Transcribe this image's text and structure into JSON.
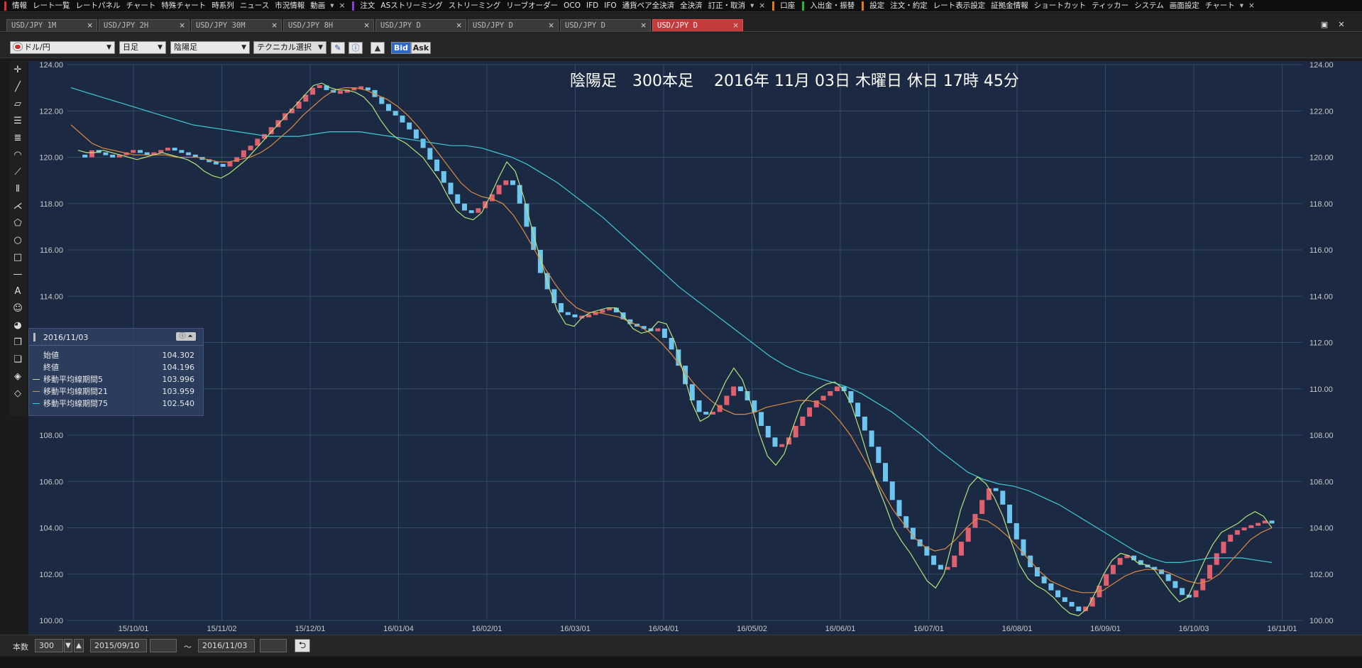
{
  "menu": {
    "groups": [
      {
        "color": "#e03030",
        "items": [
          "情報",
          "レート一覧",
          "レートパネル",
          "チャート",
          "特殊チャート",
          "時系列",
          "ニュース",
          "市況情報",
          "動画"
        ]
      },
      {
        "color": "#8a3fd0",
        "items": [
          "注文",
          "ASストリーミング",
          "ストリーミング",
          "リーブオーダー",
          "OCO",
          "IFD",
          "IFO",
          "通貨ペア全決済",
          "全決済",
          "訂正・取消"
        ]
      },
      {
        "color": "#e07a20",
        "items": [
          "口座"
        ]
      },
      {
        "color": "#30b030",
        "items": [
          "入出金・振替"
        ]
      },
      {
        "color": "#e07a20",
        "items": [
          "設定",
          "注文・約定",
          "レート表示設定",
          "証拠金情報",
          "ショートカット",
          "ティッカー",
          "システム",
          "画面設定",
          "チャート"
        ]
      }
    ]
  },
  "tabs": [
    {
      "label": "USD/JPY 1M",
      "active": false
    },
    {
      "label": "USD/JPY 2H",
      "active": false
    },
    {
      "label": "USD/JPY 30M",
      "active": false
    },
    {
      "label": "USD/JPY 8H",
      "active": false
    },
    {
      "label": "USD/JPY D",
      "active": false
    },
    {
      "label": "USD/JPY D",
      "active": false
    },
    {
      "label": "USD/JPY D",
      "active": false
    },
    {
      "label": "USD/JPY D",
      "active": true
    }
  ],
  "toolbar": {
    "pair": "ドル/円",
    "period": "日足",
    "chart_type": "陰陽足",
    "technical": "テクニカル選択",
    "bid": "Bid",
    "ask": "Ask"
  },
  "chart_header": "陰陽足　300本足　 2016年 11月 03日 木曜日 休日 17時 45分",
  "info": {
    "date": "2016/11/03",
    "rows": [
      {
        "label": "始値",
        "value": "104.302",
        "color": ""
      },
      {
        "label": "終値",
        "value": "104.196",
        "color": ""
      },
      {
        "label": "移動平均線期間5",
        "value": "103.996",
        "color": "#b8e07a"
      },
      {
        "label": "移動平均線期間21",
        "value": "103.959",
        "color": "#e08a40"
      },
      {
        "label": "移動平均線期間75",
        "value": "102.540",
        "color": "#40c8d8"
      }
    ]
  },
  "status": {
    "bars_label": "本数",
    "bars_value": "300",
    "from_date": "2015/09/10",
    "tilde": "～",
    "to_date": "2016/11/03"
  },
  "chart_data": {
    "type": "line",
    "ylim": [
      100.0,
      124.0
    ],
    "yticks": [
      "124.00",
      "122.00",
      "120.00",
      "118.00",
      "116.00",
      "114.00",
      "112.00",
      "110.00",
      "108.00",
      "106.00",
      "104.00",
      "102.00",
      "100.00"
    ],
    "xticks": [
      "15/10/01",
      "15/11/02",
      "15/12/01",
      "16/01/04",
      "16/02/01",
      "16/03/01",
      "16/04/01",
      "16/05/02",
      "16/06/01",
      "16/07/01",
      "16/08/01",
      "16/09/01",
      "16/10/03",
      "16/11/01"
    ],
    "colors": {
      "up": "#e06070",
      "down": "#6cc6f0",
      "ma5": "#b8e07a",
      "ma21": "#e08a40",
      "ma75": "#40c8d8",
      "bg": "#1b2a42",
      "grid": "#34476a",
      "text": "#c8c8c8"
    },
    "price": [
      120.1,
      120.0,
      120.3,
      120.2,
      120.1,
      120.0,
      120.1,
      120.2,
      120.3,
      120.2,
      120.1,
      120.2,
      120.3,
      120.4,
      120.3,
      120.2,
      120.1,
      120.0,
      119.9,
      119.8,
      119.7,
      119.6,
      119.8,
      120.0,
      120.3,
      120.5,
      120.8,
      121.0,
      121.3,
      121.6,
      121.9,
      122.1,
      122.4,
      122.7,
      123.0,
      123.1,
      122.9,
      122.8,
      122.8,
      122.9,
      123.0,
      123.0,
      122.9,
      122.6,
      122.3,
      122.0,
      121.8,
      121.5,
      121.2,
      120.8,
      120.4,
      119.9,
      119.4,
      118.9,
      118.4,
      118.0,
      117.7,
      117.6,
      117.8,
      118.1,
      118.4,
      118.8,
      119.0,
      118.8,
      118.0,
      117.0,
      116.0,
      115.0,
      114.3,
      113.7,
      113.3,
      113.2,
      113.1,
      113.1,
      113.2,
      113.3,
      113.4,
      113.5,
      113.3,
      113.0,
      112.8,
      112.7,
      112.6,
      112.5,
      112.6,
      112.2,
      111.7,
      111.0,
      110.2,
      109.5,
      109.0,
      108.9,
      109.0,
      109.3,
      109.7,
      110.1,
      109.9,
      109.5,
      109.0,
      108.4,
      107.9,
      107.5,
      107.6,
      107.9,
      108.4,
      108.8,
      109.2,
      109.5,
      109.7,
      109.9,
      110.1,
      109.9,
      109.4,
      108.8,
      108.2,
      107.5,
      106.8,
      106.0,
      105.2,
      104.5,
      104.0,
      103.5,
      103.2,
      102.8,
      102.4,
      102.2,
      102.3,
      102.8,
      103.4,
      104.0,
      104.6,
      105.2,
      105.7,
      105.6,
      105.0,
      104.2,
      103.5,
      102.8,
      102.3,
      101.9,
      101.6,
      101.3,
      101.0,
      100.8,
      100.6,
      100.4,
      100.6,
      101.0,
      101.5,
      102.0,
      102.4,
      102.7,
      102.8,
      102.6,
      102.4,
      102.3,
      102.2,
      102.0,
      101.7,
      101.4,
      101.1,
      101.0,
      101.3,
      101.8,
      102.4,
      102.9,
      103.4,
      103.7,
      103.9,
      104.0,
      104.1,
      104.2,
      104.3,
      104.2
    ],
    "ma5": [
      120.3,
      120.2,
      120.2,
      120.3,
      120.2,
      120.1,
      120.0,
      119.9,
      120.0,
      120.1,
      120.2,
      120.1,
      120.0,
      119.9,
      119.7,
      119.4,
      119.2,
      119.1,
      119.3,
      119.6,
      119.9,
      120.3,
      120.7,
      121.1,
      121.5,
      121.9,
      122.3,
      122.7,
      123.1,
      123.2,
      123.0,
      122.9,
      122.9,
      122.8,
      122.6,
      122.2,
      121.6,
      121.1,
      120.8,
      120.6,
      120.3,
      120.0,
      119.5,
      119.0,
      118.3,
      117.7,
      117.4,
      117.3,
      117.6,
      118.3,
      119.1,
      119.8,
      119.4,
      118.3,
      116.9,
      115.6,
      114.4,
      113.4,
      112.8,
      112.7,
      113.1,
      113.3,
      113.4,
      113.5,
      113.5,
      113.1,
      112.6,
      112.4,
      112.5,
      112.9,
      112.8,
      112.0,
      110.7,
      109.4,
      108.6,
      108.8,
      109.5,
      110.3,
      110.9,
      110.4,
      109.4,
      108.1,
      107.1,
      106.7,
      107.2,
      108.3,
      109.3,
      109.7,
      110.0,
      110.2,
      110.3,
      110.0,
      109.3,
      108.2,
      107.0,
      105.9,
      105.0,
      104.0,
      103.4,
      102.9,
      102.3,
      101.7,
      101.4,
      102.0,
      103.4,
      104.8,
      105.8,
      106.2,
      105.9,
      105.3,
      104.5,
      103.4,
      102.4,
      101.8,
      101.5,
      101.3,
      101.0,
      100.6,
      100.3,
      100.2,
      100.5,
      101.2,
      102.0,
      102.6,
      102.9,
      102.8,
      102.5,
      102.4,
      102.2,
      101.7,
      101.2,
      100.8,
      101.0,
      101.8,
      102.6,
      103.3,
      103.8,
      104.0,
      104.2,
      104.5,
      104.7,
      104.5,
      104.0
    ],
    "ma21": [
      121.4,
      121.0,
      120.6,
      120.4,
      120.3,
      120.2,
      120.1,
      120.1,
      120.1,
      120.1,
      120.0,
      120.0,
      120.0,
      119.9,
      119.8,
      119.8,
      119.9,
      120.0,
      120.2,
      120.5,
      120.9,
      121.3,
      121.8,
      122.2,
      122.6,
      122.9,
      123.0,
      123.0,
      122.9,
      122.7,
      122.5,
      122.2,
      121.8,
      121.3,
      120.7,
      120.1,
      119.5,
      118.9,
      118.5,
      118.3,
      118.2,
      118.0,
      117.5,
      116.8,
      116.0,
      115.2,
      114.5,
      113.9,
      113.5,
      113.3,
      113.3,
      113.2,
      113.1,
      112.9,
      112.7,
      112.4,
      112.0,
      111.5,
      110.9,
      110.3,
      109.8,
      109.4,
      109.1,
      108.9,
      108.9,
      109.0,
      109.2,
      109.3,
      109.4,
      109.5,
      109.5,
      109.4,
      109.1,
      108.6,
      108.0,
      107.2,
      106.4,
      105.6,
      104.8,
      104.2,
      103.6,
      103.2,
      103.0,
      103.1,
      103.5,
      104.0,
      104.4,
      104.3,
      104.0,
      103.6,
      103.1,
      102.6,
      102.1,
      101.7,
      101.5,
      101.3,
      101.2,
      101.2,
      101.3,
      101.6,
      101.9,
      102.1,
      102.2,
      102.2,
      102.1,
      101.9,
      101.7,
      101.6,
      101.7,
      102.0,
      102.5,
      103.0,
      103.5,
      103.8,
      104.0
    ],
    "ma75": [
      123.0,
      122.8,
      122.6,
      122.4,
      122.2,
      122.0,
      121.8,
      121.6,
      121.4,
      121.3,
      121.2,
      121.1,
      121.0,
      120.9,
      120.9,
      120.9,
      121.0,
      121.1,
      121.1,
      121.1,
      121.0,
      120.9,
      120.8,
      120.7,
      120.6,
      120.5,
      120.5,
      120.4,
      120.2,
      120.0,
      119.7,
      119.3,
      118.9,
      118.4,
      117.9,
      117.4,
      116.8,
      116.2,
      115.6,
      115.0,
      114.4,
      113.9,
      113.4,
      112.9,
      112.4,
      111.9,
      111.4,
      111.0,
      110.7,
      110.5,
      110.3,
      110.1,
      109.8,
      109.4,
      109.0,
      108.5,
      108.0,
      107.4,
      106.9,
      106.4,
      106.1,
      105.9,
      105.8,
      105.6,
      105.3,
      105.0,
      104.6,
      104.2,
      103.8,
      103.4,
      103.0,
      102.7,
      102.5,
      102.5,
      102.6,
      102.7,
      102.7,
      102.7,
      102.6,
      102.5
    ]
  }
}
